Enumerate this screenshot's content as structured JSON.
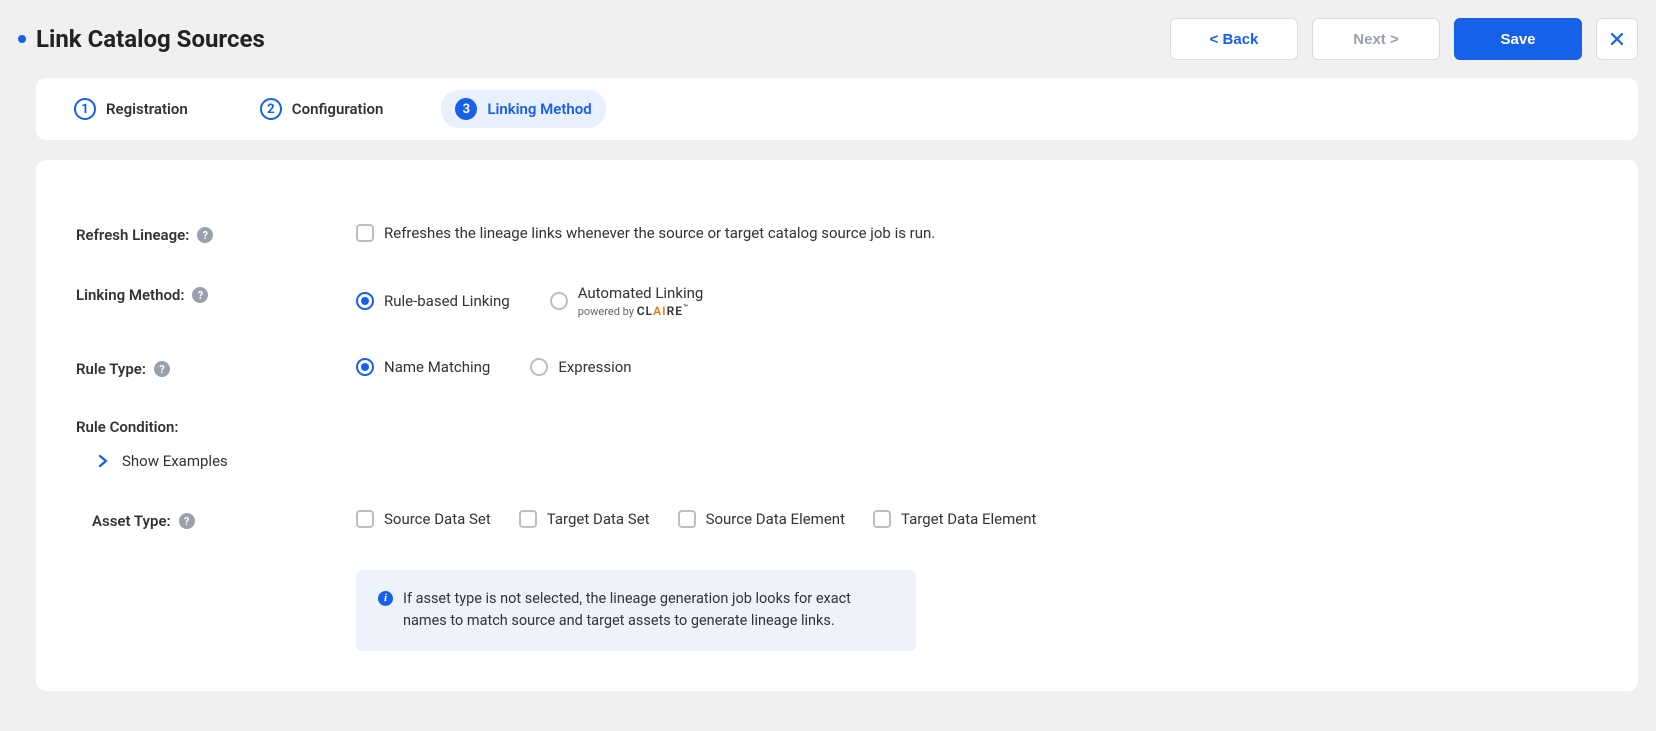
{
  "header": {
    "title": "Link Catalog Sources",
    "back": "< Back",
    "next": "Next >",
    "save": "Save"
  },
  "steps": [
    {
      "num": "1",
      "label": "Registration"
    },
    {
      "num": "2",
      "label": "Configuration"
    },
    {
      "num": "3",
      "label": "Linking Method"
    }
  ],
  "form": {
    "refreshLineage": {
      "label": "Refresh Lineage:",
      "desc": "Refreshes the lineage links whenever the source or target catalog source job is run."
    },
    "linkingMethod": {
      "label": "Linking Method:",
      "options": {
        "rule": "Rule-based Linking",
        "auto": "Automated Linking",
        "autoSub": "powered by "
      }
    },
    "ruleType": {
      "label": "Rule Type:",
      "options": {
        "name": "Name Matching",
        "expr": "Expression"
      }
    },
    "ruleCondition": {
      "label": "Rule Condition:",
      "showExamples": "Show Examples"
    },
    "assetType": {
      "label": "Asset Type:",
      "options": {
        "srcDataSet": "Source Data Set",
        "tgtDataSet": "Target Data Set",
        "srcDataElem": "Source Data Element",
        "tgtDataElem": "Target Data Element"
      }
    },
    "info": "If asset type is not selected, the lineage generation job looks for exact names to match source and target assets to generate lineage links."
  }
}
